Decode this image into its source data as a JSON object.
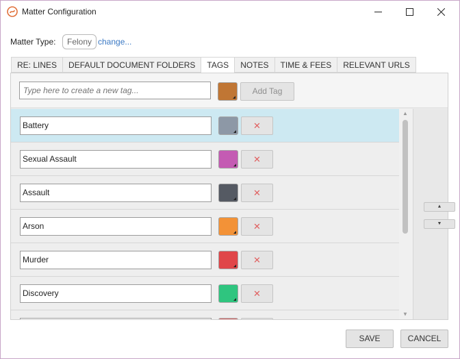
{
  "window": {
    "title": "Matter Configuration",
    "icon": "app-logo-icon"
  },
  "matter_type": {
    "label": "Matter Type:",
    "value": "Felony",
    "change_link": "change..."
  },
  "tabs": [
    {
      "label": "RE: LINES",
      "active": false
    },
    {
      "label": "DEFAULT DOCUMENT FOLDERS",
      "active": false
    },
    {
      "label": "TAGS",
      "active": true
    },
    {
      "label": "NOTES",
      "active": false
    },
    {
      "label": "TIME & FEES",
      "active": false
    },
    {
      "label": "RELEVANT URLS",
      "active": false
    }
  ],
  "new_tag": {
    "placeholder": "Type here to create a new tag...",
    "color": "#c07634",
    "add_label": "Add Tag"
  },
  "tags": [
    {
      "name": "Battery",
      "color": "#8d98a6",
      "selected": true
    },
    {
      "name": "Sexual Assault",
      "color": "#c45bb3",
      "selected": false
    },
    {
      "name": "Assault",
      "color": "#555a63",
      "selected": false
    },
    {
      "name": "Arson",
      "color": "#f39237",
      "selected": false
    },
    {
      "name": "Murder",
      "color": "#e04649",
      "selected": false
    },
    {
      "name": "Discovery",
      "color": "#2fc57f",
      "selected": false
    },
    {
      "name": "",
      "color": "#e56a6a",
      "selected": false
    }
  ],
  "delete_icon": "close-icon",
  "footer": {
    "save_label": "SAVE",
    "cancel_label": "CANCEL"
  }
}
